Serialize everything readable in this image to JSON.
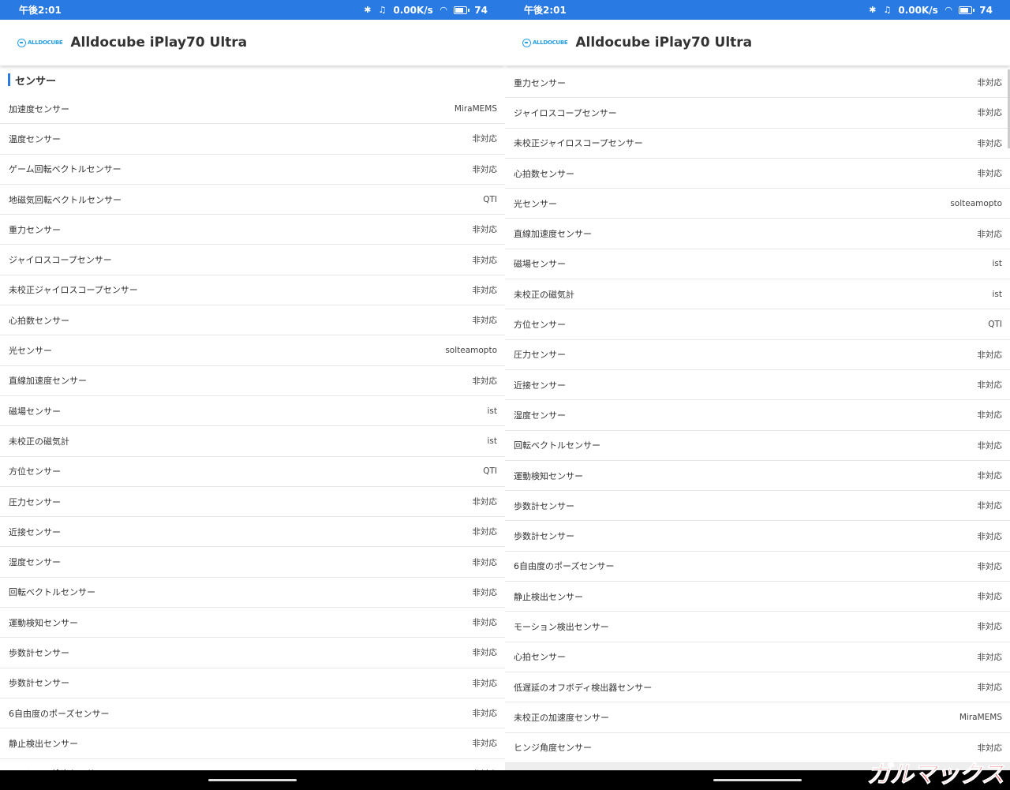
{
  "status": {
    "time": "午後2:01",
    "speed": "0.00K/s",
    "battery": "74"
  },
  "app": {
    "title": "Alldocube iPlay70 Ultra",
    "logo_text": "ALLDOCUBE"
  },
  "section": {
    "title": "センサー"
  },
  "left_rows": [
    {
      "label": "加速度センサー",
      "value": "MiraMEMS"
    },
    {
      "label": "温度センサー",
      "value": "非対応"
    },
    {
      "label": "ゲーム回転ベクトルセンサー",
      "value": "非対応"
    },
    {
      "label": "地磁気回転ベクトルセンサー",
      "value": "QTI"
    },
    {
      "label": "重力センサー",
      "value": "非対応"
    },
    {
      "label": "ジャイロスコープセンサー",
      "value": "非対応"
    },
    {
      "label": "未校正ジャイロスコープセンサー",
      "value": "非対応"
    },
    {
      "label": "心拍数センサー",
      "value": "非対応"
    },
    {
      "label": "光センサー",
      "value": "solteamopto"
    },
    {
      "label": "直線加速度センサー",
      "value": "非対応"
    },
    {
      "label": "磁場センサー",
      "value": "ist"
    },
    {
      "label": "未校正の磁気計",
      "value": "ist"
    },
    {
      "label": "方位センサー",
      "value": "QTI"
    },
    {
      "label": "圧力センサー",
      "value": "非対応"
    },
    {
      "label": "近接センサー",
      "value": "非対応"
    },
    {
      "label": "湿度センサー",
      "value": "非対応"
    },
    {
      "label": "回転ベクトルセンサー",
      "value": "非対応"
    },
    {
      "label": "運動検知センサー",
      "value": "非対応"
    },
    {
      "label": "歩数計センサー",
      "value": "非対応"
    },
    {
      "label": "歩数計センサー",
      "value": "非対応"
    },
    {
      "label": "6自由度のポーズセンサー",
      "value": "非対応"
    },
    {
      "label": "静止検出センサー",
      "value": "非対応"
    },
    {
      "label": "モーション検出センサー",
      "value": "非対応"
    }
  ],
  "right_rows": [
    {
      "label": "重力センサー",
      "value": "非対応"
    },
    {
      "label": "ジャイロスコープセンサー",
      "value": "非対応"
    },
    {
      "label": "未校正ジャイロスコープセンサー",
      "value": "非対応"
    },
    {
      "label": "心拍数センサー",
      "value": "非対応"
    },
    {
      "label": "光センサー",
      "value": "solteamopto"
    },
    {
      "label": "直線加速度センサー",
      "value": "非対応"
    },
    {
      "label": "磁場センサー",
      "value": "ist"
    },
    {
      "label": "未校正の磁気計",
      "value": "ist"
    },
    {
      "label": "方位センサー",
      "value": "QTI"
    },
    {
      "label": "圧力センサー",
      "value": "非対応"
    },
    {
      "label": "近接センサー",
      "value": "非対応"
    },
    {
      "label": "湿度センサー",
      "value": "非対応"
    },
    {
      "label": "回転ベクトルセンサー",
      "value": "非対応"
    },
    {
      "label": "運動検知センサー",
      "value": "非対応"
    },
    {
      "label": "歩数計センサー",
      "value": "非対応"
    },
    {
      "label": "歩数計センサー",
      "value": "非対応"
    },
    {
      "label": "6自由度のポーズセンサー",
      "value": "非対応"
    },
    {
      "label": "静止検出センサー",
      "value": "非対応"
    },
    {
      "label": "モーション検出センサー",
      "value": "非対応"
    },
    {
      "label": "心拍センサー",
      "value": "非対応"
    },
    {
      "label": "低遅延のオフボディ検出器センサー",
      "value": "非対応"
    },
    {
      "label": "未校正の加速度センサー",
      "value": "MiraMEMS"
    },
    {
      "label": "ヒンジ角度センサー",
      "value": "非対応"
    }
  ],
  "watermark": "ガルマックス",
  "colors": {
    "accent": "#2a7ae4",
    "logo": "#27a0e3",
    "watermark": "#e0262b"
  }
}
